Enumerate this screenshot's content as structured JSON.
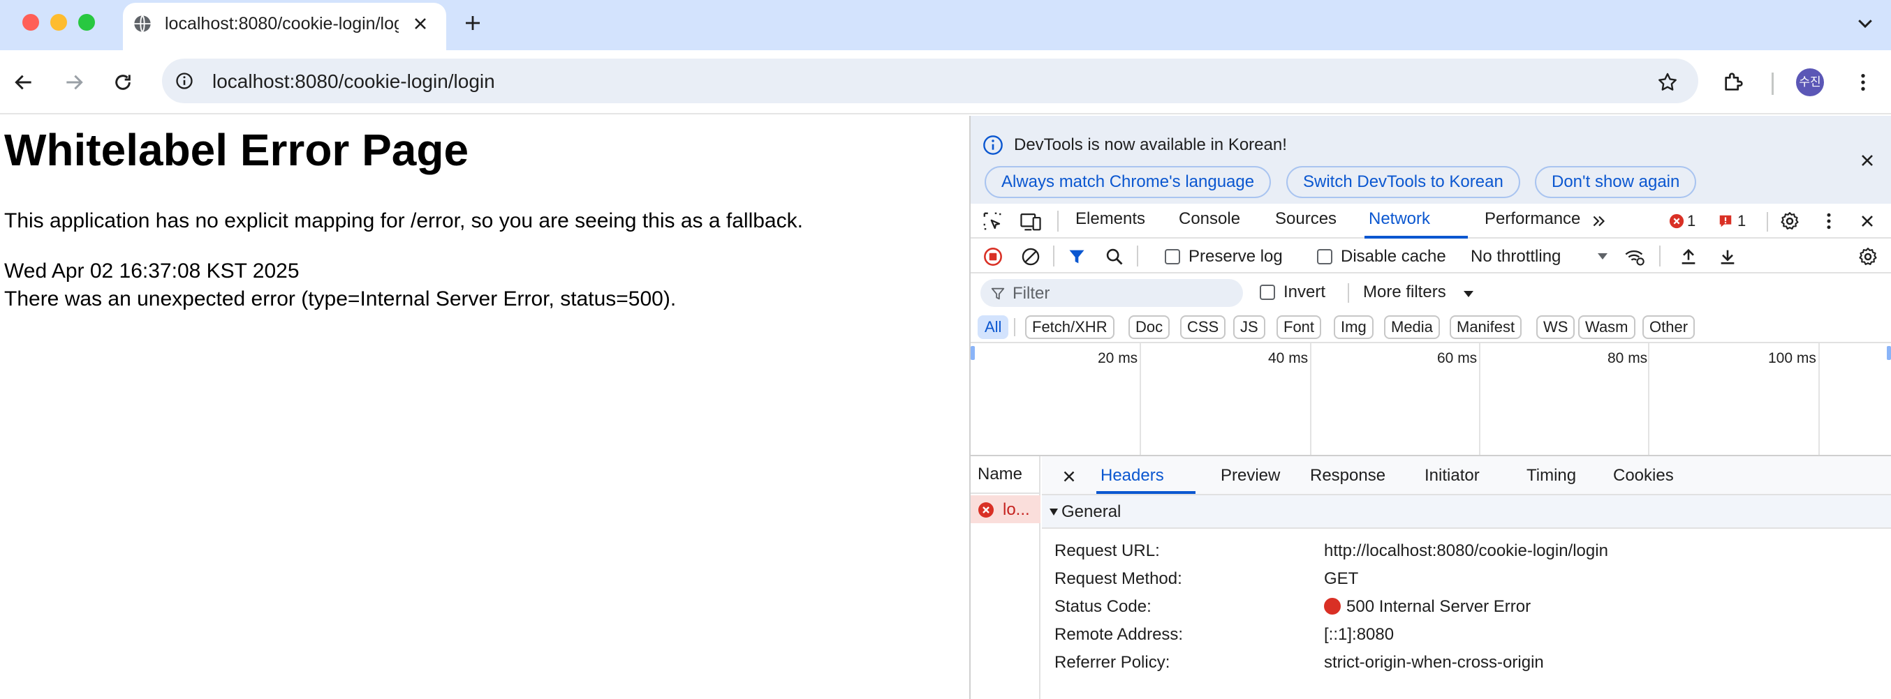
{
  "browser": {
    "tab_title": "localhost:8080/cookie-login/login",
    "url": "localhost:8080/cookie-login/login",
    "profile_initials": "수진"
  },
  "page": {
    "heading": "Whitelabel Error Page",
    "message": "This application has no explicit mapping for /error, so you are seeing this as a fallback.",
    "timestamp": "Wed Apr 02 16:37:08 KST 2025",
    "error": "There was an unexpected error (type=Internal Server Error, status=500)."
  },
  "devtools": {
    "infobar": {
      "text": "DevTools is now available in Korean!",
      "buttons": [
        "Always match Chrome's language",
        "Switch DevTools to Korean",
        "Don't show again"
      ]
    },
    "tabs": [
      "Elements",
      "Console",
      "Sources",
      "Network",
      "Performance"
    ],
    "active_tab": "Network",
    "error_count": "1",
    "issue_count": "1",
    "controls": {
      "preserve_log": "Preserve log",
      "disable_cache": "Disable cache",
      "throttling": "No throttling"
    },
    "filter": {
      "placeholder": "Filter",
      "invert": "Invert",
      "more_filters": "More filters"
    },
    "type_filters": [
      "All",
      "Fetch/XHR",
      "Doc",
      "CSS",
      "JS",
      "Font",
      "Img",
      "Media",
      "Manifest",
      "WS",
      "Wasm",
      "Other"
    ],
    "timeline_labels": [
      "20 ms",
      "40 ms",
      "60 ms",
      "80 ms",
      "100 ms"
    ],
    "name_header": "Name",
    "request_name": "lo...",
    "detail_tabs": [
      "Headers",
      "Preview",
      "Response",
      "Initiator",
      "Timing",
      "Cookies"
    ],
    "general": {
      "label": "General",
      "rows": [
        {
          "key": "Request URL:",
          "value": "http://localhost:8080/cookie-login/login"
        },
        {
          "key": "Request Method:",
          "value": "GET"
        },
        {
          "key": "Status Code:",
          "value": "500 Internal Server Error"
        },
        {
          "key": "Remote Address:",
          "value": "[::1]:8080"
        },
        {
          "key": "Referrer Policy:",
          "value": "strict-origin-when-cross-origin"
        }
      ]
    }
  },
  "colors": {
    "accent": "#0b57d0",
    "error": "#d93025",
    "tabstrip": "#d3e3fd"
  }
}
